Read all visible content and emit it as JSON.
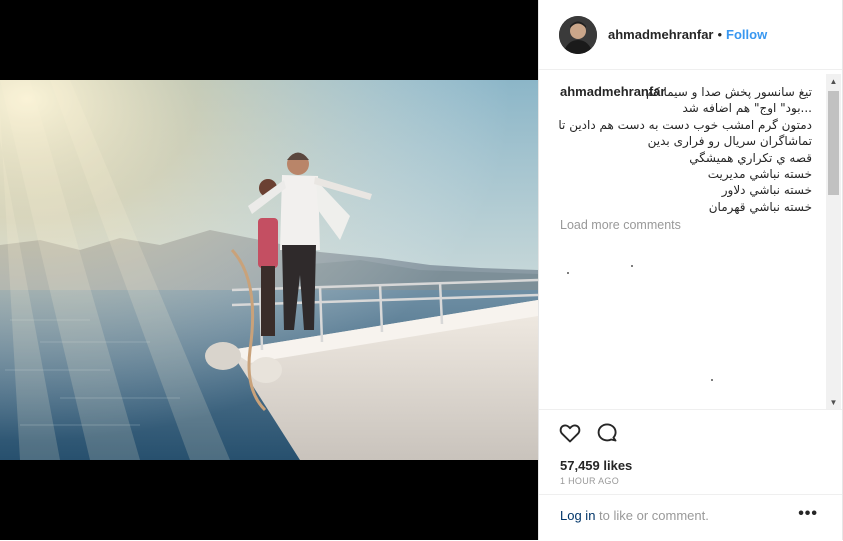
{
  "post": {
    "username": "ahmadmehranfar",
    "separator": "•",
    "follow_label": "Follow",
    "caption_username": "ahmadmehranfar",
    "caption_lines": [
      "تیغ سانسور پخش صدا و سیما کم",
      "...بود\" اوج\" هم اضافه شد",
      "دمتون گرم امشب خوب دست به دست هم دادین تا",
      "تماشاگران سریال رو فراری بدین",
      "قصه ي تکراري هميشگي",
      "خسته نباشي مديريت",
      "خسته نباشي دلاور",
      "خسته نباشي قهرمان"
    ],
    "load_more_label": "Load more comments",
    "likes": "57,459 likes",
    "time": "1 HOUR AGO",
    "login_link": "Log in",
    "login_suffix": " to like or comment.",
    "more_options": "•••"
  },
  "icons": {
    "like": "heart-icon",
    "comment": "comment-icon",
    "scroll_up": "arrow-up-icon",
    "scroll_down": "arrow-down-icon"
  },
  "colors": {
    "follow": "#3897f0",
    "text": "#262626",
    "muted": "#999999",
    "login_link": "#003569"
  }
}
